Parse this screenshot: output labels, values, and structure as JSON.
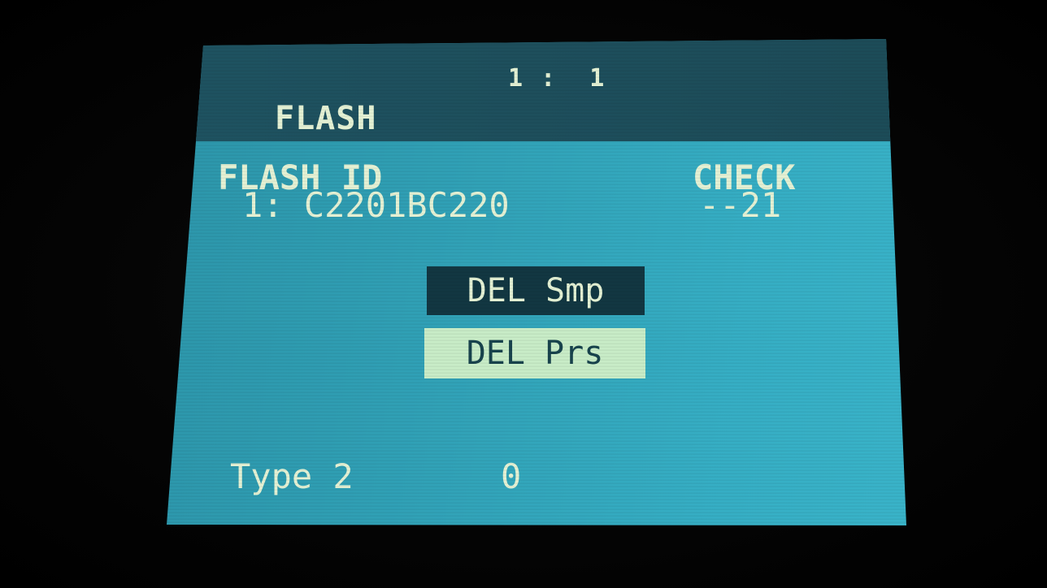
{
  "header": {
    "position_readout": "1 :  1",
    "title": "FLASH"
  },
  "flash_info": {
    "id_label": "FLASH ID",
    "id_value": "1: C2201BC220",
    "check_label": "CHECK",
    "check_value": "--21"
  },
  "menu": {
    "items": [
      {
        "label": "DEL Smp",
        "selected": false
      },
      {
        "label": "DEL Prs",
        "selected": true
      }
    ]
  },
  "footer": {
    "type_label": "Type 2",
    "type_value": "0"
  },
  "colors": {
    "screen_bg": "#2f9db2",
    "header_bg": "#1f5463",
    "text": "#e4f1d4",
    "menu_item_bg": "#123742",
    "menu_item_highlight_bg": "#c8ecc7"
  }
}
